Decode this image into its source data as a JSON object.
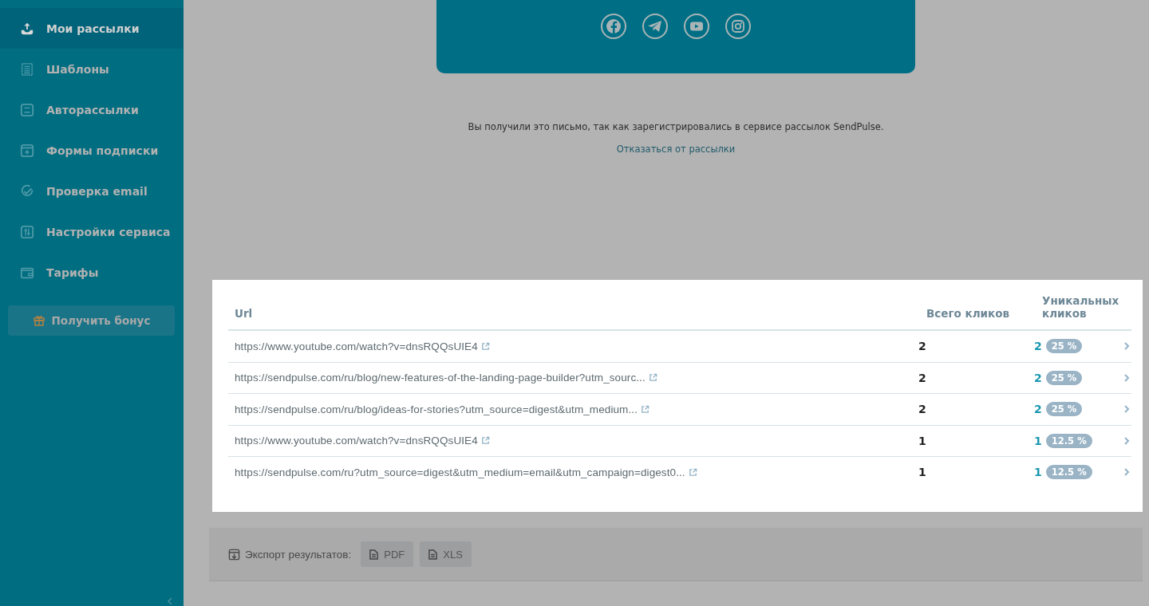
{
  "sidebar": {
    "items": [
      {
        "label": "Мои рассылки",
        "selected": true
      },
      {
        "label": "Шаблоны",
        "selected": false
      },
      {
        "label": "Авторассылки",
        "selected": false
      },
      {
        "label": "Формы подписки",
        "selected": false
      },
      {
        "label": "Проверка email",
        "selected": false
      },
      {
        "label": "Настройки сервиса",
        "selected": false
      },
      {
        "label": "Тарифы",
        "selected": false
      }
    ],
    "bonus_button": "Получить бонус"
  },
  "email_preview": {
    "footer_text": "Вы получили это письмо, так как зарегистрировались в сервисе рассылок SendPulse.",
    "unsubscribe_link": "Отказаться от рассылки"
  },
  "table": {
    "columns": [
      "Url",
      "Всего кликов",
      "Уникальных кликов"
    ],
    "rows": [
      {
        "url": "https://www.youtube.com/watch?v=dnsRQQsUIE4",
        "total": "2",
        "unique": "2",
        "percent": "25 %"
      },
      {
        "url": "https://sendpulse.com/ru/blog/new-features-of-the-landing-page-builder?utm_sourc...",
        "total": "2",
        "unique": "2",
        "percent": "25 %"
      },
      {
        "url": "https://sendpulse.com/ru/blog/ideas-for-stories?utm_source=digest&utm_medium...",
        "total": "2",
        "unique": "2",
        "percent": "25 %"
      },
      {
        "url": "https://www.youtube.com/watch?v=dnsRQQsUIE4",
        "total": "1",
        "unique": "1",
        "percent": "12.5 %"
      },
      {
        "url": "https://sendpulse.com/ru?utm_source=digest&utm_medium=email&utm_campaign=digest0...",
        "total": "1",
        "unique": "1",
        "percent": "12.5 %"
      }
    ]
  },
  "export": {
    "label": "Экспорт результатов:",
    "buttons": [
      "PDF",
      "XLS"
    ]
  }
}
